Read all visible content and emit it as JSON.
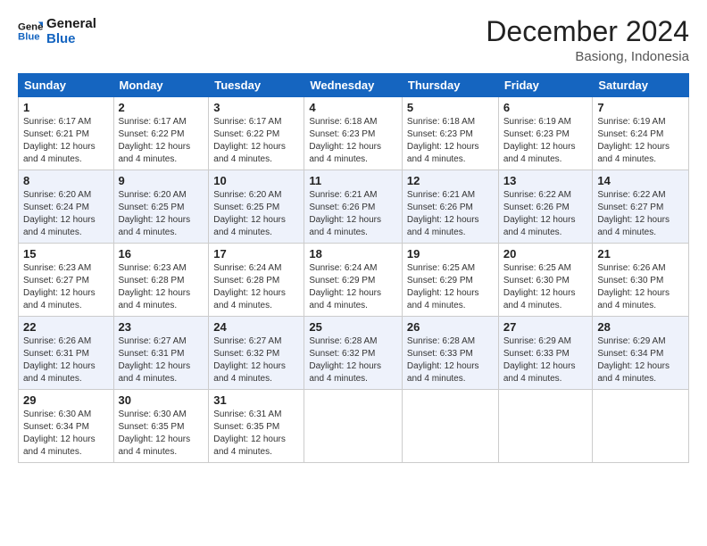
{
  "logo": {
    "line1": "General",
    "line2": "Blue"
  },
  "title": "December 2024",
  "location": "Basiong, Indonesia",
  "days_of_week": [
    "Sunday",
    "Monday",
    "Tuesday",
    "Wednesday",
    "Thursday",
    "Friday",
    "Saturday"
  ],
  "weeks": [
    [
      {
        "day": "1",
        "sunrise": "6:17 AM",
        "sunset": "6:21 PM",
        "daylight": "12 hours and 4 minutes."
      },
      {
        "day": "2",
        "sunrise": "6:17 AM",
        "sunset": "6:22 PM",
        "daylight": "12 hours and 4 minutes."
      },
      {
        "day": "3",
        "sunrise": "6:17 AM",
        "sunset": "6:22 PM",
        "daylight": "12 hours and 4 minutes."
      },
      {
        "day": "4",
        "sunrise": "6:18 AM",
        "sunset": "6:23 PM",
        "daylight": "12 hours and 4 minutes."
      },
      {
        "day": "5",
        "sunrise": "6:18 AM",
        "sunset": "6:23 PM",
        "daylight": "12 hours and 4 minutes."
      },
      {
        "day": "6",
        "sunrise": "6:19 AM",
        "sunset": "6:23 PM",
        "daylight": "12 hours and 4 minutes."
      },
      {
        "day": "7",
        "sunrise": "6:19 AM",
        "sunset": "6:24 PM",
        "daylight": "12 hours and 4 minutes."
      }
    ],
    [
      {
        "day": "8",
        "sunrise": "6:20 AM",
        "sunset": "6:24 PM",
        "daylight": "12 hours and 4 minutes."
      },
      {
        "day": "9",
        "sunrise": "6:20 AM",
        "sunset": "6:25 PM",
        "daylight": "12 hours and 4 minutes."
      },
      {
        "day": "10",
        "sunrise": "6:20 AM",
        "sunset": "6:25 PM",
        "daylight": "12 hours and 4 minutes."
      },
      {
        "day": "11",
        "sunrise": "6:21 AM",
        "sunset": "6:26 PM",
        "daylight": "12 hours and 4 minutes."
      },
      {
        "day": "12",
        "sunrise": "6:21 AM",
        "sunset": "6:26 PM",
        "daylight": "12 hours and 4 minutes."
      },
      {
        "day": "13",
        "sunrise": "6:22 AM",
        "sunset": "6:26 PM",
        "daylight": "12 hours and 4 minutes."
      },
      {
        "day": "14",
        "sunrise": "6:22 AM",
        "sunset": "6:27 PM",
        "daylight": "12 hours and 4 minutes."
      }
    ],
    [
      {
        "day": "15",
        "sunrise": "6:23 AM",
        "sunset": "6:27 PM",
        "daylight": "12 hours and 4 minutes."
      },
      {
        "day": "16",
        "sunrise": "6:23 AM",
        "sunset": "6:28 PM",
        "daylight": "12 hours and 4 minutes."
      },
      {
        "day": "17",
        "sunrise": "6:24 AM",
        "sunset": "6:28 PM",
        "daylight": "12 hours and 4 minutes."
      },
      {
        "day": "18",
        "sunrise": "6:24 AM",
        "sunset": "6:29 PM",
        "daylight": "12 hours and 4 minutes."
      },
      {
        "day": "19",
        "sunrise": "6:25 AM",
        "sunset": "6:29 PM",
        "daylight": "12 hours and 4 minutes."
      },
      {
        "day": "20",
        "sunrise": "6:25 AM",
        "sunset": "6:30 PM",
        "daylight": "12 hours and 4 minutes."
      },
      {
        "day": "21",
        "sunrise": "6:26 AM",
        "sunset": "6:30 PM",
        "daylight": "12 hours and 4 minutes."
      }
    ],
    [
      {
        "day": "22",
        "sunrise": "6:26 AM",
        "sunset": "6:31 PM",
        "daylight": "12 hours and 4 minutes."
      },
      {
        "day": "23",
        "sunrise": "6:27 AM",
        "sunset": "6:31 PM",
        "daylight": "12 hours and 4 minutes."
      },
      {
        "day": "24",
        "sunrise": "6:27 AM",
        "sunset": "6:32 PM",
        "daylight": "12 hours and 4 minutes."
      },
      {
        "day": "25",
        "sunrise": "6:28 AM",
        "sunset": "6:32 PM",
        "daylight": "12 hours and 4 minutes."
      },
      {
        "day": "26",
        "sunrise": "6:28 AM",
        "sunset": "6:33 PM",
        "daylight": "12 hours and 4 minutes."
      },
      {
        "day": "27",
        "sunrise": "6:29 AM",
        "sunset": "6:33 PM",
        "daylight": "12 hours and 4 minutes."
      },
      {
        "day": "28",
        "sunrise": "6:29 AM",
        "sunset": "6:34 PM",
        "daylight": "12 hours and 4 minutes."
      }
    ],
    [
      {
        "day": "29",
        "sunrise": "6:30 AM",
        "sunset": "6:34 PM",
        "daylight": "12 hours and 4 minutes."
      },
      {
        "day": "30",
        "sunrise": "6:30 AM",
        "sunset": "6:35 PM",
        "daylight": "12 hours and 4 minutes."
      },
      {
        "day": "31",
        "sunrise": "6:31 AM",
        "sunset": "6:35 PM",
        "daylight": "12 hours and 4 minutes."
      },
      null,
      null,
      null,
      null
    ]
  ]
}
